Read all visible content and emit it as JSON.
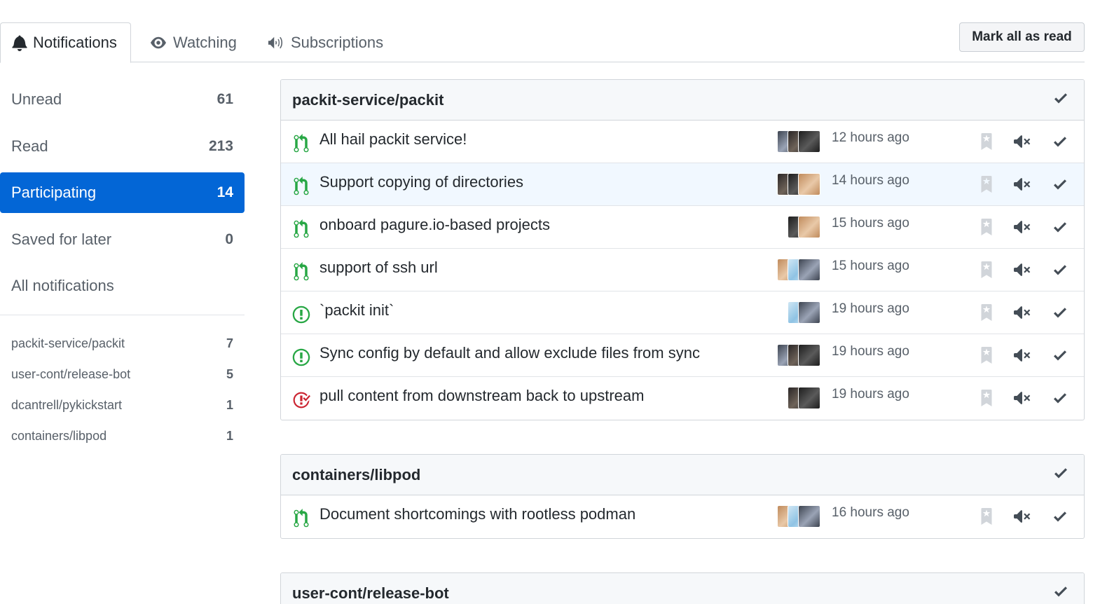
{
  "tabs": [
    {
      "label": "Notifications",
      "icon": "bell-icon",
      "selected": true
    },
    {
      "label": "Watching",
      "icon": "eye-icon",
      "selected": false
    },
    {
      "label": "Subscriptions",
      "icon": "megaphone-icon",
      "selected": false
    }
  ],
  "mark_all_label": "Mark all as read",
  "filters": [
    {
      "label": "Unread",
      "count": "61",
      "active": false
    },
    {
      "label": "Read",
      "count": "213",
      "active": false
    },
    {
      "label": "Participating",
      "count": "14",
      "active": true
    },
    {
      "label": "Saved for later",
      "count": "0",
      "active": false
    },
    {
      "label": "All notifications",
      "count": "",
      "active": false
    }
  ],
  "repo_filters": [
    {
      "label": "packit-service/packit",
      "count": "7"
    },
    {
      "label": "user-cont/release-bot",
      "count": "5"
    },
    {
      "label": "dcantrell/pykickstart",
      "count": "1"
    },
    {
      "label": "containers/libpod",
      "count": "1"
    }
  ],
  "colors": {
    "accent": "#0366d6",
    "open": "#28a745",
    "closed": "#cb2431",
    "muted": "#586069"
  },
  "groups": [
    {
      "repo": "packit-service/packit",
      "items": [
        {
          "type": "pull-request-icon",
          "title": "All hail packit service!",
          "time": "12 hours ago",
          "avatars": 3,
          "highlight": false
        },
        {
          "type": "pull-request-icon",
          "title": "Support copying of directories",
          "time": "14 hours ago",
          "avatars": 3,
          "highlight": true
        },
        {
          "type": "pull-request-icon",
          "title": "onboard pagure.io-based projects",
          "time": "15 hours ago",
          "avatars": 2,
          "highlight": false
        },
        {
          "type": "pull-request-icon",
          "title": "support of ssh url",
          "time": "15 hours ago",
          "avatars": 3,
          "highlight": false
        },
        {
          "type": "issue-open-icon",
          "title": "`packit init`",
          "time": "19 hours ago",
          "avatars": 2,
          "highlight": false
        },
        {
          "type": "issue-open-icon",
          "title": "Sync config by default and allow exclude files from sync",
          "time": "19 hours ago",
          "avatars": 3,
          "highlight": false
        },
        {
          "type": "issue-closed-icon",
          "title": "pull content from downstream back to upstream",
          "time": "19 hours ago",
          "avatars": 2,
          "highlight": false
        }
      ]
    },
    {
      "repo": "containers/libpod",
      "items": [
        {
          "type": "pull-request-icon",
          "title": "Document shortcomings with rootless podman",
          "time": "16 hours ago",
          "avatars": 3,
          "highlight": false
        }
      ]
    },
    {
      "repo": "user-cont/release-bot",
      "items": []
    }
  ]
}
